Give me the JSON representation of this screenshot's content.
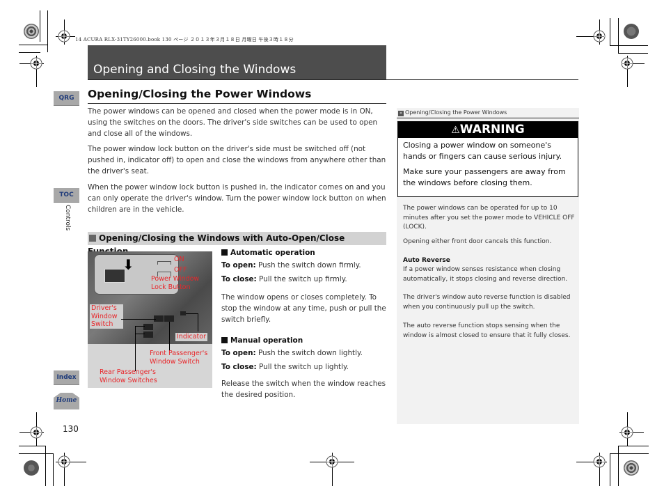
{
  "print_header": "14 ACURA RLX-31TY26000.book  130 ページ  ２０１３年３月１８日  月曜日  午後３時１８分",
  "chapter": {
    "title": "Opening and Closing the Windows"
  },
  "side_nav": {
    "qrg": "QRG",
    "toc": "TOC",
    "chapter_label": "Controls",
    "index": "Index",
    "home": "Home"
  },
  "section": {
    "title": "Opening/Closing the Power Windows",
    "paragraphs": [
      "The power windows can be opened and closed when the power mode is in ON, using the switches on the doors. The driver's side switches can be used to open and close all of the windows.",
      "The power window lock button on the driver's side must be switched off (not pushed in, indicator off) to open and close the windows from anywhere other than the driver's seat.",
      "When the power window lock button is pushed in, the indicator comes on and you can only operate the driver's window. Turn the power window lock button on when children are in the vehicle."
    ]
  },
  "subsection": {
    "title": "Opening/Closing the Windows with Auto-Open/Close Function",
    "figure_labels": {
      "on": "ON",
      "off": "OFF",
      "lock_button": "Power Window Lock Button",
      "drivers_switch": "Driver's Window Switch",
      "indicator": "Indicator",
      "front_passenger": "Front Passenger's Window Switch",
      "rear_passenger": "Rear Passenger's Window Switches"
    },
    "automatic": {
      "heading": "Automatic operation",
      "open_label": "To open:",
      "open_text": "Push the switch down firmly.",
      "close_label": "To close:",
      "close_text": "Pull the switch up firmly.",
      "note": "The window opens or closes completely. To stop the window at any time, push or pull the switch briefly."
    },
    "manual": {
      "heading": "Manual operation",
      "open_label": "To open:",
      "open_text": "Push the switch down lightly.",
      "close_label": "To close:",
      "close_text": "Pull the switch up lightly.",
      "note": "Release the switch when the window reaches the desired position."
    }
  },
  "sidebar": {
    "crumb": "Opening/Closing the Power Windows",
    "warning": {
      "title": "WARNING",
      "lines": [
        "Closing a power window on someone's hands or fingers can cause serious injury.",
        "Make sure your passengers are away from the windows before closing them."
      ]
    },
    "notes": [
      "The power windows can be operated for up to 10 minutes after you set the power mode to VEHICLE OFF (LOCK).",
      "Opening either front door cancels this function."
    ],
    "auto_reverse": {
      "heading": "Auto Reverse",
      "text": "If a power window senses resistance when closing automatically, it stops closing and reverse direction.",
      "notes": [
        "The driver's window auto reverse function is disabled when you continuously pull up the switch.",
        "The auto reverse function stops sensing when the window is almost closed to ensure that it fully closes."
      ]
    }
  },
  "page_number": "130"
}
